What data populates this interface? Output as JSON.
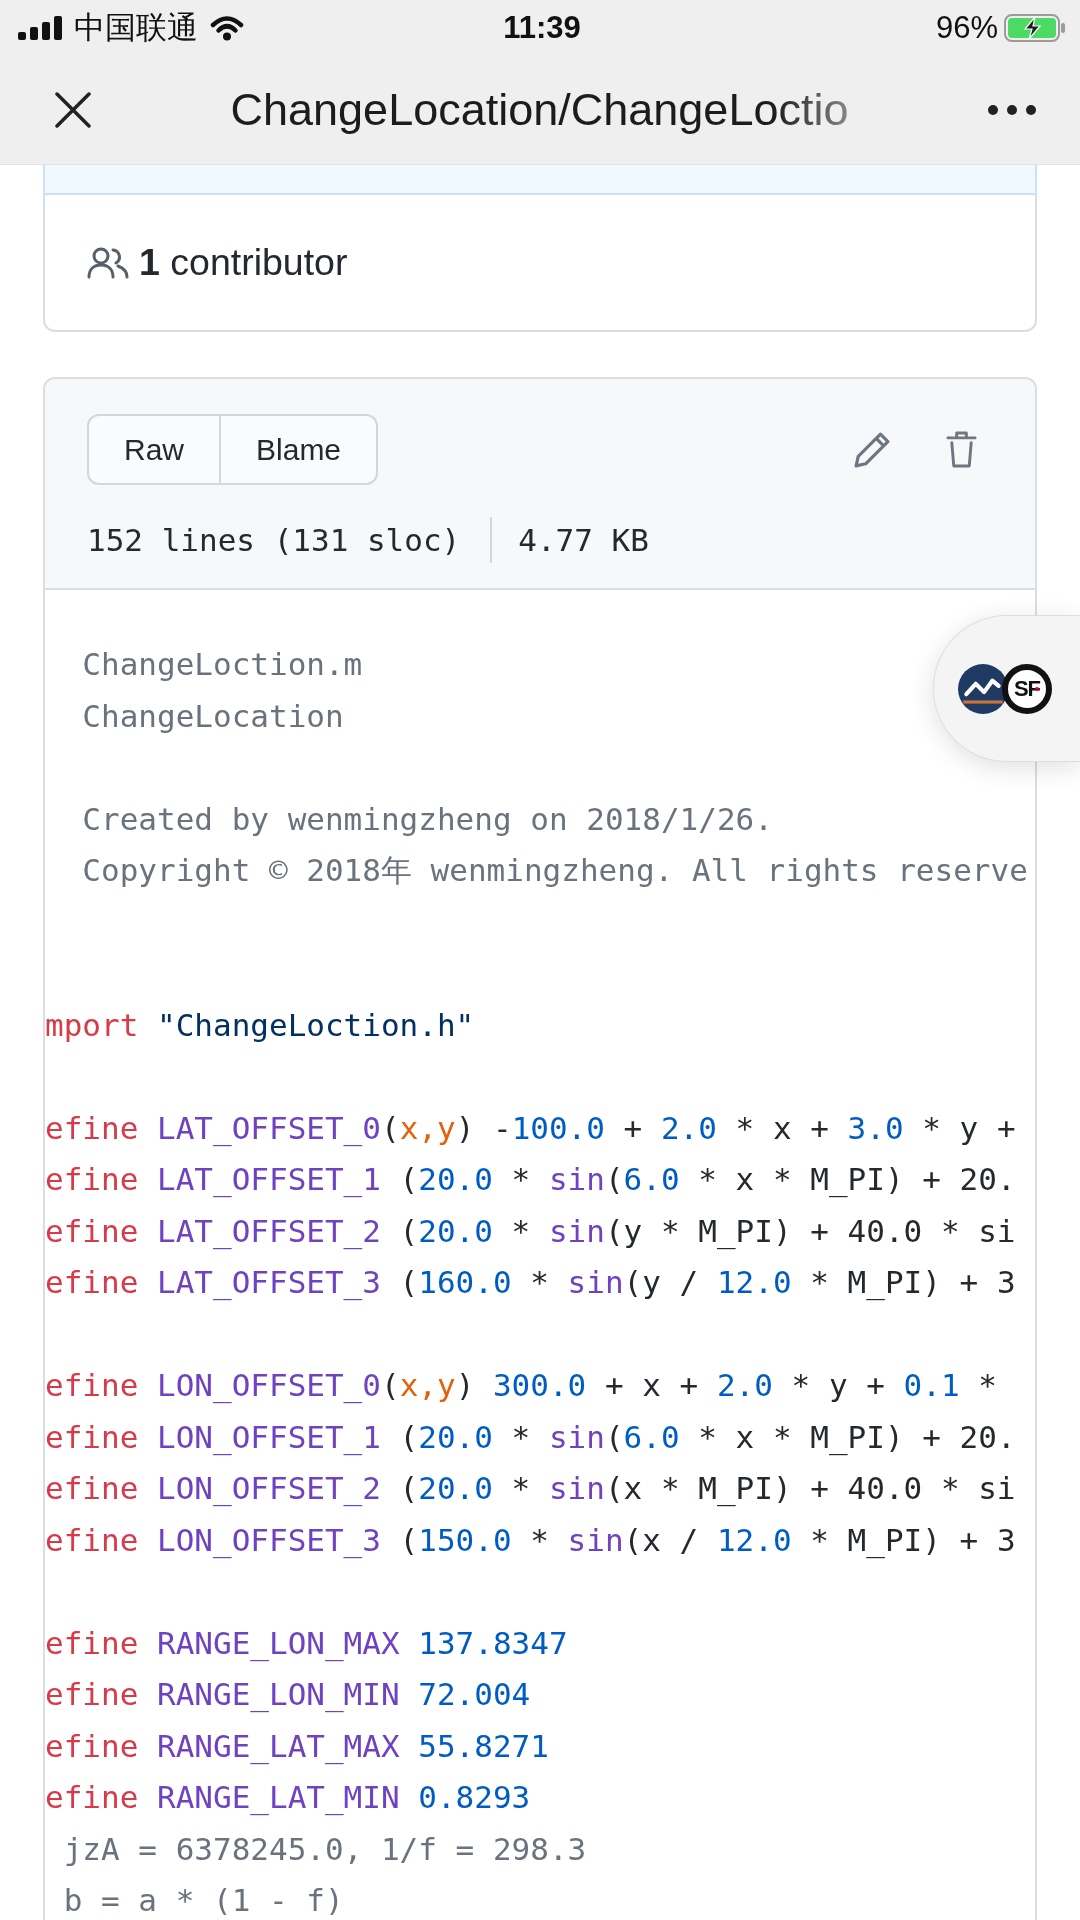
{
  "status_bar": {
    "carrier": "中国联通",
    "time": "11:39",
    "battery_percent": "96%",
    "charging": true
  },
  "nav_bar": {
    "title": "ChangeLocation/ChangeLoctio"
  },
  "contributors": {
    "text": "**1** contributor"
  },
  "file_header": {
    "buttons": [
      "Raw",
      "Blame"
    ],
    "lines_info": "152 lines (131 sloc)",
    "size": "4.77 KB"
  },
  "code": {
    "lines": [
      {
        "kind": "comment",
        "text": "  ChangeLoction.m"
      },
      {
        "kind": "comment",
        "text": "  ChangeLocation"
      },
      {
        "kind": "blank"
      },
      {
        "kind": "comment",
        "text": "  Created by wenmingzheng on 2018/1/26."
      },
      {
        "kind": "comment",
        "text": "  Copyright © 2018年 wenmingzheng. All rights reserve"
      },
      {
        "kind": "blank"
      },
      {
        "kind": "blank"
      },
      {
        "kind": "code",
        "tokens": [
          {
            "text": "mport ",
            "kind": "keyword"
          },
          {
            "text": "\"ChangeLoction.h\"",
            "kind": "string"
          }
        ]
      },
      {
        "kind": "blank"
      },
      {
        "kind": "code",
        "tokens": [
          {
            "text": "efine ",
            "kind": "keyword"
          },
          {
            "text": "LAT_OFFSET_0",
            "kind": "entity"
          },
          {
            "text": "(",
            "kind": "plain"
          },
          {
            "text": "x,y",
            "kind": "param"
          },
          {
            "text": ") -",
            "kind": "plain"
          },
          {
            "text": "100.0",
            "kind": "number"
          },
          {
            "text": " + ",
            "kind": "plain"
          },
          {
            "text": "2.0",
            "kind": "number"
          },
          {
            "text": " * x + ",
            "kind": "plain"
          },
          {
            "text": "3.0",
            "kind": "number"
          },
          {
            "text": " * y +",
            "kind": "plain"
          }
        ]
      },
      {
        "kind": "code",
        "tokens": [
          {
            "text": "efine ",
            "kind": "keyword"
          },
          {
            "text": "LAT_OFFSET_1",
            "kind": "entity"
          },
          {
            "text": " (",
            "kind": "plain"
          },
          {
            "text": "20.0",
            "kind": "number"
          },
          {
            "text": " * ",
            "kind": "plain"
          },
          {
            "text": "sin",
            "kind": "entity"
          },
          {
            "text": "(",
            "kind": "plain"
          },
          {
            "text": "6.0",
            "kind": "number"
          },
          {
            "text": " * x * M_PI) + 20.",
            "kind": "plain"
          }
        ]
      },
      {
        "kind": "code",
        "tokens": [
          {
            "text": "efine ",
            "kind": "keyword"
          },
          {
            "text": "LAT_OFFSET_2",
            "kind": "entity"
          },
          {
            "text": " (",
            "kind": "plain"
          },
          {
            "text": "20.0",
            "kind": "number"
          },
          {
            "text": " * ",
            "kind": "plain"
          },
          {
            "text": "sin",
            "kind": "entity"
          },
          {
            "text": "(y * M_PI) + 40.0 * si",
            "kind": "plain"
          }
        ]
      },
      {
        "kind": "code",
        "tokens": [
          {
            "text": "efine ",
            "kind": "keyword"
          },
          {
            "text": "LAT_OFFSET_3",
            "kind": "entity"
          },
          {
            "text": " (",
            "kind": "plain"
          },
          {
            "text": "160.0",
            "kind": "number"
          },
          {
            "text": " * ",
            "kind": "plain"
          },
          {
            "text": "sin",
            "kind": "entity"
          },
          {
            "text": "(y / ",
            "kind": "plain"
          },
          {
            "text": "12.0",
            "kind": "number"
          },
          {
            "text": " * M_PI) + 3",
            "kind": "plain"
          }
        ]
      },
      {
        "kind": "blank"
      },
      {
        "kind": "code",
        "tokens": [
          {
            "text": "efine ",
            "kind": "keyword"
          },
          {
            "text": "LON_OFFSET_0",
            "kind": "entity"
          },
          {
            "text": "(",
            "kind": "plain"
          },
          {
            "text": "x,y",
            "kind": "param"
          },
          {
            "text": ") ",
            "kind": "plain"
          },
          {
            "text": "300.0",
            "kind": "number"
          },
          {
            "text": " + x + ",
            "kind": "plain"
          },
          {
            "text": "2.0",
            "kind": "number"
          },
          {
            "text": " * y + ",
            "kind": "plain"
          },
          {
            "text": "0.1",
            "kind": "number"
          },
          {
            "text": " *",
            "kind": "plain"
          }
        ]
      },
      {
        "kind": "code",
        "tokens": [
          {
            "text": "efine ",
            "kind": "keyword"
          },
          {
            "text": "LON_OFFSET_1",
            "kind": "entity"
          },
          {
            "text": " (",
            "kind": "plain"
          },
          {
            "text": "20.0",
            "kind": "number"
          },
          {
            "text": " * ",
            "kind": "plain"
          },
          {
            "text": "sin",
            "kind": "entity"
          },
          {
            "text": "(",
            "kind": "plain"
          },
          {
            "text": "6.0",
            "kind": "number"
          },
          {
            "text": " * x * M_PI) + 20.",
            "kind": "plain"
          }
        ]
      },
      {
        "kind": "code",
        "tokens": [
          {
            "text": "efine ",
            "kind": "keyword"
          },
          {
            "text": "LON_OFFSET_2",
            "kind": "entity"
          },
          {
            "text": " (",
            "kind": "plain"
          },
          {
            "text": "20.0",
            "kind": "number"
          },
          {
            "text": " * ",
            "kind": "plain"
          },
          {
            "text": "sin",
            "kind": "entity"
          },
          {
            "text": "(x * M_PI) + 40.0 * si",
            "kind": "plain"
          }
        ]
      },
      {
        "kind": "code",
        "tokens": [
          {
            "text": "efine ",
            "kind": "keyword"
          },
          {
            "text": "LON_OFFSET_3",
            "kind": "entity"
          },
          {
            "text": " (",
            "kind": "plain"
          },
          {
            "text": "150.0",
            "kind": "number"
          },
          {
            "text": " * ",
            "kind": "plain"
          },
          {
            "text": "sin",
            "kind": "entity"
          },
          {
            "text": "(x / ",
            "kind": "plain"
          },
          {
            "text": "12.0",
            "kind": "number"
          },
          {
            "text": " * M_PI) + 3",
            "kind": "plain"
          }
        ]
      },
      {
        "kind": "blank"
      },
      {
        "kind": "code",
        "tokens": [
          {
            "text": "efine ",
            "kind": "keyword"
          },
          {
            "text": "RANGE_LON_MAX ",
            "kind": "entity"
          },
          {
            "text": "137.8347",
            "kind": "number"
          }
        ]
      },
      {
        "kind": "code",
        "tokens": [
          {
            "text": "efine ",
            "kind": "keyword"
          },
          {
            "text": "RANGE_LON_MIN ",
            "kind": "entity"
          },
          {
            "text": "72.004",
            "kind": "number"
          }
        ]
      },
      {
        "kind": "code",
        "tokens": [
          {
            "text": "efine ",
            "kind": "keyword"
          },
          {
            "text": "RANGE_LAT_MAX ",
            "kind": "entity"
          },
          {
            "text": "55.8271",
            "kind": "number"
          }
        ]
      },
      {
        "kind": "code",
        "tokens": [
          {
            "text": "efine ",
            "kind": "keyword"
          },
          {
            "text": "RANGE_LAT_MIN ",
            "kind": "entity"
          },
          {
            "text": "0.8293",
            "kind": "number"
          }
        ]
      },
      {
        "kind": "comment",
        "text": " jzA = 6378245.0, 1/f = 298.3"
      },
      {
        "kind": "comment",
        "text": " b = a * (1 - f)"
      }
    ]
  },
  "floating_window": {
    "logo_text": "SF"
  }
}
